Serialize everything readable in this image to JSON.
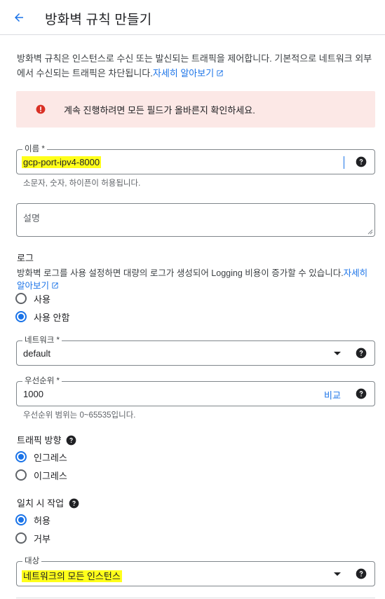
{
  "header": {
    "title": "방화벽 규칙 만들기"
  },
  "description": {
    "text": "방화벽 규칙은 인스턴스로 수신 또는 발신되는 트래픽을 제어합니다. 기본적으로 네트워크 외부에서 수신되는 트래픽은 차단됩니다.",
    "link": "자세히 알아보기"
  },
  "error": {
    "message": "계속 진행하려면 모든 필드가 올바른지 확인하세요.",
    "color": "#d93025"
  },
  "name_field": {
    "label": "이름 *",
    "value": "gcp-port-ipv4-8000",
    "hint": "소문자, 숫자, 하이픈이 허용됩니다."
  },
  "description_field": {
    "placeholder": "설명"
  },
  "logs": {
    "title": "로그",
    "text": "방화벽 로그를 사용 설정하면 대량의 로그가 생성되어 Logging 비용이 증가할 수 있습니다.",
    "link_part1": "자세히",
    "link_part2": "알아보기",
    "options": [
      {
        "label": "사용",
        "checked": false
      },
      {
        "label": "사용 안함",
        "checked": true
      }
    ]
  },
  "network_field": {
    "label": "네트워크 *",
    "value": "default"
  },
  "priority_field": {
    "label": "우선순위 *",
    "value": "1000",
    "compare_link": "비교",
    "hint": "우선순위 범위는 0~65535입니다."
  },
  "traffic_direction": {
    "title": "트래픽 방향",
    "options": [
      {
        "label": "인그레스",
        "checked": true
      },
      {
        "label": "이그레스",
        "checked": false
      }
    ]
  },
  "action_on_match": {
    "title": "일치 시 작업",
    "options": [
      {
        "label": "허용",
        "checked": true
      },
      {
        "label": "거부",
        "checked": false
      }
    ]
  },
  "target_field": {
    "label": "대상",
    "value": "네트워크의 모든 인스턴스"
  },
  "colors": {
    "accent": "#1a73e8",
    "highlight": "#ffff1a",
    "error_bg": "#fce8e6"
  }
}
